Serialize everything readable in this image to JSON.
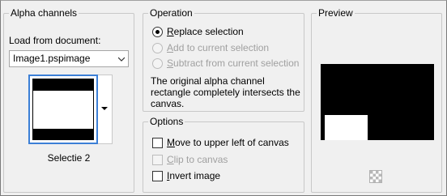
{
  "alpha": {
    "group_title": "Alpha channels",
    "load_label": "Load from document:",
    "document_select": "Image1.pspimage",
    "selection_name": "Selectie 2"
  },
  "operation": {
    "group_title": "Operation",
    "options": [
      {
        "prefix": "",
        "ul": "R",
        "rest": "eplace selection",
        "checked": true,
        "enabled": true
      },
      {
        "prefix": "",
        "ul": "A",
        "rest": "dd to current selection",
        "checked": false,
        "enabled": false
      },
      {
        "prefix": "",
        "ul": "S",
        "rest": "ubtract from current selection",
        "checked": false,
        "enabled": false
      }
    ],
    "info": "The original alpha channel rectangle completely intersects the canvas."
  },
  "options": {
    "group_title": "Options",
    "items": [
      {
        "ul": "M",
        "rest": "ove to upper left of canvas",
        "checked": false,
        "enabled": true
      },
      {
        "ul": "C",
        "rest": "lip to canvas",
        "checked": false,
        "enabled": false
      },
      {
        "ul": "I",
        "rest": "nvert image",
        "checked": false,
        "enabled": true
      }
    ]
  },
  "preview": {
    "group_title": "Preview"
  }
}
